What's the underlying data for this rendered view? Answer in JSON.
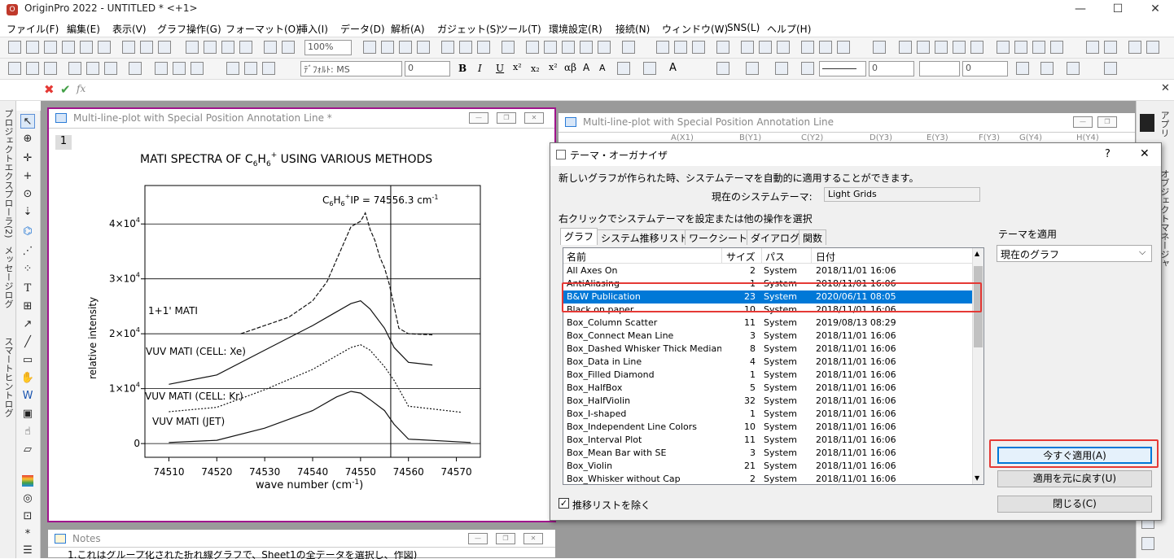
{
  "app": {
    "icon_letter": "O",
    "title": "OriginPro 2022 - UNTITLED * <+1>"
  },
  "menu": [
    "ファイル(F)",
    "編集(E)",
    "表示(V)",
    "グラフ操作(G)",
    "フォーマット(O)",
    "挿入(I)",
    "データ(D)",
    "解析(A)",
    "ガジェット(S)",
    "ツール(T)",
    "環境設定(R)",
    "接続(N)",
    "ウィンドウ(W)",
    "SNS(L)",
    "ヘルプ(H)"
  ],
  "toolbar": {
    "zoom": "100%",
    "font": "ﾃﾞﾌｫﾙﾄ: MS",
    "font_size": "0",
    "size_a": "0",
    "size_b": "0"
  },
  "fx": "fx",
  "left_tabs": {
    "explorer": "プロジェクトエクスプローラ(2)",
    "messages": "メッセージログ",
    "hints": "スマートヒントログ"
  },
  "right_tabs": {
    "apps": "アプリ",
    "object_manager": "オブジェクトマネージャ"
  },
  "graph_window": {
    "title": "Multi-line-plot with Special Position Annotation Line *",
    "layer": "1",
    "plot_title_pre": "MATI SPECTRA OF C",
    "plot_title_s1": "6",
    "plot_title_h": "H",
    "plot_title_s2": "6",
    "plot_title_sup": "+",
    "plot_title_post": " USING VARIOUS METHODS",
    "xlabel": "wave number (cm",
    "xlabel_sup": "-1",
    "xlabel_end": ")",
    "ylabel": "relative intensity",
    "annotation_pre": "C",
    "annotation_s1": "6",
    "annotation_h": "H",
    "annotation_s2": "6",
    "annotation_sup": "+",
    "annotation_post": "IP = 74556.3 cm",
    "annotation_unit_sup": "-1",
    "labels": [
      "1+1' MATI",
      "VUV MATI (CELL: Xe)",
      "VUV MATI (CELL: Kr)",
      "VUV MATI (JET)"
    ]
  },
  "chart_data": {
    "type": "line",
    "title": "MATI SPECTRA OF C6H6+ USING VARIOUS METHODS",
    "xlabel": "wave number (cm-1)",
    "ylabel": "relative intensity",
    "xlim": [
      74505,
      74575
    ],
    "x_ticks": [
      "74510",
      "74520",
      "74530",
      "74540",
      "74550",
      "74560",
      "74570"
    ],
    "y_ticks": [
      {
        "label": "0",
        "value": 0
      },
      {
        "label": "1×10",
        "sup": "4",
        "value": 10000
      },
      {
        "label": "2×10",
        "sup": "4",
        "value": 20000
      },
      {
        "label": "3×10",
        "sup": "4",
        "value": 30000
      },
      {
        "label": "4×10",
        "sup": "4",
        "value": 40000
      }
    ],
    "ylim": [
      -2500,
      47000
    ],
    "vline_x": 74556.3,
    "series": [
      {
        "name": "1+1' MATI",
        "x": [
          74525,
          74530,
          74535,
          74540,
          74543,
          74546,
          74548,
          74550,
          74551,
          74552,
          74553,
          74554,
          74555,
          74556,
          74557,
          74558,
          74560,
          74565
        ],
        "y": [
          20000,
          21500,
          23000,
          26000,
          29500,
          35500,
          39500,
          40500,
          42000,
          39000,
          37000,
          34000,
          32000,
          29000,
          25000,
          21000,
          20000,
          19800
        ]
      },
      {
        "name": "VUV MATI (CELL: Xe)",
        "x": [
          74510,
          74520,
          74530,
          74540,
          74545,
          74548,
          74550,
          74552,
          74555,
          74557,
          74560,
          74565
        ],
        "y": [
          10800,
          12500,
          17000,
          21500,
          24000,
          25500,
          26000,
          24500,
          21000,
          17500,
          14800,
          14300
        ]
      },
      {
        "name": "VUV MATI (CELL: Kr)",
        "x": [
          74510,
          74520,
          74530,
          74540,
          74545,
          74548,
          74550,
          74552,
          74555,
          74557,
          74560,
          74571
        ],
        "y": [
          5800,
          6600,
          9800,
          13500,
          16000,
          17500,
          18000,
          17000,
          14000,
          11500,
          6800,
          5700
        ]
      },
      {
        "name": "VUV MATI (JET)",
        "x": [
          74510,
          74520,
          74530,
          74540,
          74545,
          74548,
          74550,
          74552,
          74555,
          74557,
          74560,
          74573
        ],
        "y": [
          200,
          600,
          2800,
          6000,
          8500,
          9500,
          9200,
          8000,
          6000,
          3500,
          800,
          200
        ]
      }
    ]
  },
  "sheet_window": {
    "title": "Multi-line-plot with Special Position Annotation Line",
    "cols": [
      "A(X1)",
      "B(Y1)",
      "C(Y2)",
      "D(Y3)",
      "E(Y3)",
      "F(Y3)",
      "G(Y4)",
      "H(Y4)"
    ]
  },
  "notes_window": {
    "title": "Notes",
    "text": "1.これはグループ化された折れ線グラフで、Sheet1の全データを選択し、作図)"
  },
  "dialog": {
    "title": "テーマ・オーガナイザ",
    "help": "?",
    "close": "✕",
    "desc": "新しいグラフが作られた時、システムテーマを自動的に適用することができます。",
    "current_label": "現在のシステムテーマ:",
    "current_value": "Light Grids",
    "instruction": "右クリックでシステムテーマを設定または他の操作を選択",
    "tabs": [
      "グラフ",
      "システム推移リスト",
      "ワークシート",
      "ダイアログ",
      "関数"
    ],
    "headers": [
      "名前",
      "サイズ",
      "パス",
      "日付"
    ],
    "rows": [
      {
        "name": "All Axes On",
        "size": "2",
        "path": "System",
        "date": "2018/11/01 16:06"
      },
      {
        "name": "AntiAliasing",
        "size": "1",
        "path": "System",
        "date": "2018/11/01 16:06"
      },
      {
        "name": "B&W Publication",
        "size": "23",
        "path": "System",
        "date": "2020/06/11 08:05"
      },
      {
        "name": "Black on paper",
        "size": "10",
        "path": "System",
        "date": "2018/11/01 16:06"
      },
      {
        "name": "Box_Column Scatter",
        "size": "11",
        "path": "System",
        "date": "2019/08/13 08:29"
      },
      {
        "name": "Box_Connect Mean Line",
        "size": "3",
        "path": "System",
        "date": "2018/11/01 16:06"
      },
      {
        "name": "Box_Dashed Whisker Thick Median",
        "size": "8",
        "path": "System",
        "date": "2018/11/01 16:06"
      },
      {
        "name": "Box_Data in Line",
        "size": "4",
        "path": "System",
        "date": "2018/11/01 16:06"
      },
      {
        "name": "Box_Filled Diamond",
        "size": "1",
        "path": "System",
        "date": "2018/11/01 16:06"
      },
      {
        "name": "Box_HalfBox",
        "size": "5",
        "path": "System",
        "date": "2018/11/01 16:06"
      },
      {
        "name": "Box_HalfViolin",
        "size": "32",
        "path": "System",
        "date": "2018/11/01 16:06"
      },
      {
        "name": "Box_I-shaped",
        "size": "1",
        "path": "System",
        "date": "2018/11/01 16:06"
      },
      {
        "name": "Box_Independent Line Colors",
        "size": "10",
        "path": "System",
        "date": "2018/11/01 16:06"
      },
      {
        "name": "Box_Interval Plot",
        "size": "11",
        "path": "System",
        "date": "2018/11/01 16:06"
      },
      {
        "name": "Box_Mean Bar with SE",
        "size": "3",
        "path": "System",
        "date": "2018/11/01 16:06"
      },
      {
        "name": "Box_Violin",
        "size": "21",
        "path": "System",
        "date": "2018/11/01 16:06"
      },
      {
        "name": "Box_Whisker without Cap",
        "size": "2",
        "path": "System",
        "date": "2018/11/01 16:06"
      }
    ],
    "apply_label": "テーマを適用",
    "apply_target": "現在のグラフ",
    "apply_now": "今すぐ適用(A)",
    "revert": "適用を元に戻す(U)",
    "close_btn": "閉じる(C)",
    "exclude_check": "推移リストを除く",
    "exclude_checked": "✓"
  },
  "colors": {
    "selection": "#0078d7",
    "highlight": "#e53935",
    "active_frame": "#a0148c"
  }
}
